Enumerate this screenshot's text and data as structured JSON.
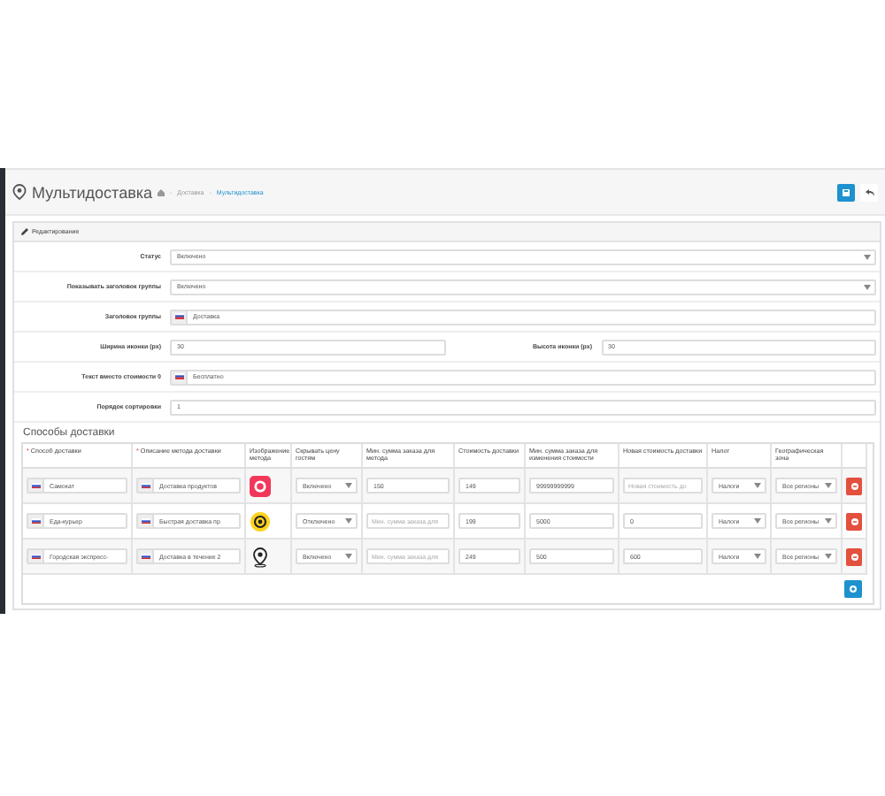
{
  "page": {
    "title": "Мультидоставка",
    "breadcrumbs": [
      {
        "separator": "-",
        "label": "Доставка",
        "selected": false
      },
      {
        "separator": "-",
        "label": "Мультидоставка",
        "selected": true
      }
    ]
  },
  "panel": {
    "title": "Редактирование"
  },
  "form": [
    {
      "kind": "select",
      "label": "Статус",
      "value": "Включено"
    },
    {
      "kind": "select",
      "label": "Показывать заголовок группы",
      "value": "Включено"
    },
    {
      "kind": "flag",
      "label": "Заголовок группы",
      "value": "Доставка"
    },
    {
      "kind": "pair",
      "label": "Ширина иконки (px)",
      "value": "30",
      "label_2": "Высота иконки (px)",
      "value_2": "30"
    },
    {
      "kind": "flag",
      "label": "Текст вместо стоимости 0",
      "value": "Бесплатно"
    },
    {
      "kind": "input",
      "label": "Порядок сортировки",
      "value": "1"
    }
  ],
  "methods": {
    "title": "Способы доставки",
    "columns": [
      {
        "marker": "*",
        "label": "Способ доставки"
      },
      {
        "marker": "*",
        "label": "Описание метода доставки"
      },
      {
        "label": "Изображение метода"
      },
      {
        "label": "Скрывать цену гостям"
      },
      {
        "label": "Мин. сумма заказа для метода"
      },
      {
        "label": "Стоимость доставки"
      },
      {
        "label": "Мин. сумма заказа для изменения стоимости"
      },
      {
        "label": "Новая стоимость доставки"
      },
      {
        "label": "Налог"
      },
      {
        "label": "Географическая зона"
      }
    ],
    "rows": [
      {
        "name": "Самокат",
        "description": "Доставка продуктов",
        "hide_price": "Включено",
        "min_sum": {
          "value": "150"
        },
        "cost": "149",
        "min_change": {
          "value": "99999999999"
        },
        "new_cost": {
          "placeholder": "Новая стоимость до"
        },
        "tax": "Налоги",
        "zone": "Все регионы"
      },
      {
        "name": "Еда-курьер",
        "description": "Быстрая доставка пр",
        "hide_price": "Отключено",
        "min_sum": {
          "placeholder": "Мин. сумма заказа для"
        },
        "cost": "199",
        "min_change": {
          "value": "5000"
        },
        "new_cost": {
          "value": "0"
        },
        "tax": "Налоги",
        "zone": "Все регионы"
      },
      {
        "name": "Городская экспресс-",
        "description": "Доставка в течение 2",
        "hide_price": "Включено",
        "min_sum": {
          "placeholder": "Мин. сумма заказа для"
        },
        "cost": "249",
        "min_change": {
          "value": "500"
        },
        "new_cost": {
          "value": "600"
        },
        "tax": "Налоги",
        "zone": "Все регионы"
      }
    ]
  }
}
